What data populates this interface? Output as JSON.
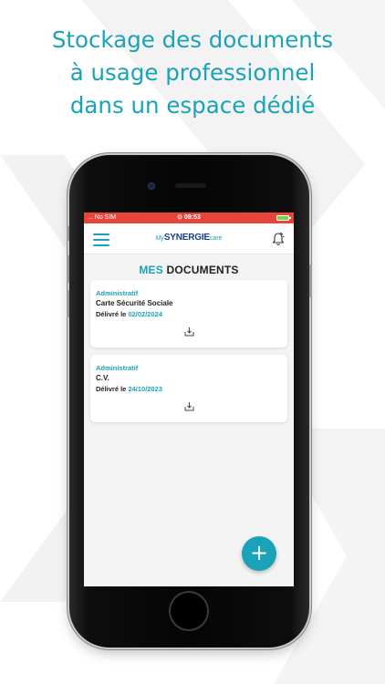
{
  "headline": {
    "line1": "Stockage des documents",
    "line2": "à usage professionnel",
    "line3": "dans un espace dédié"
  },
  "status_bar": {
    "carrier": "... No SIM",
    "time": "09:53"
  },
  "header": {
    "logo_my": "My",
    "logo_synergie": "SYNERGIE",
    "logo_care": "care",
    "menu_icon": "hamburger-menu-icon",
    "bell_icon": "notification-bell-icon"
  },
  "page": {
    "title_part1": "MES",
    "title_part2": " DOCUMENTS"
  },
  "documents": [
    {
      "category": "Administratif",
      "name": "Carte Sécurité Sociale",
      "date_label": "Délivré le ",
      "date": "02/02/2024"
    },
    {
      "category": "Administratif",
      "name": "C.V.",
      "date_label": "Délivré le ",
      "date": "24/10/2023"
    }
  ],
  "fab": {
    "label": "+"
  },
  "colors": {
    "accent": "#1aa3b8",
    "brand_dark": "#1a3f8a",
    "status_bar": "#e8443a"
  }
}
